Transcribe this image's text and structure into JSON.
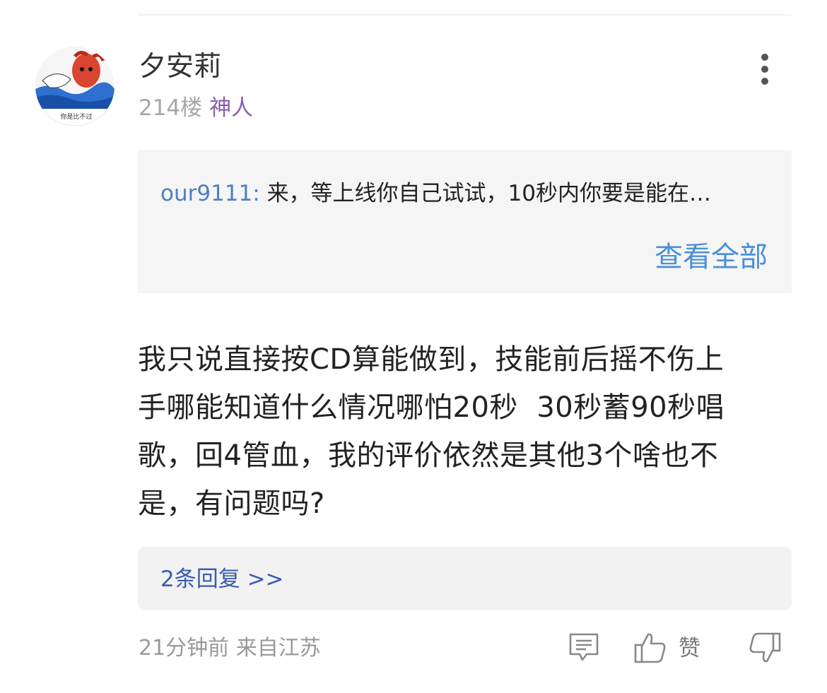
{
  "post": {
    "username": "夕安莉",
    "floor": "214楼",
    "badge": "神人",
    "quote": {
      "author": "our9111:",
      "text": "来，等上线你自己试试，10秒内你要是能在…",
      "view_all": "查看全部"
    },
    "lines": [
      "我只说直接按CD算能做到，技能前后摇不伤上",
      "手哪能知道什么情况哪怕20秒  30秒蓄90秒唱",
      "歌，回4管血，我的评价依然是其他3个啥也不",
      "是，有问题吗?"
    ],
    "replies_link": "2条回复 >>",
    "time_location": "21分钟前 来自江苏",
    "like_label": "赞"
  },
  "avatar": {
    "caption": "你是比不过"
  },
  "icons": {
    "more": "more-vertical-icon",
    "comment": "comment-icon",
    "like": "thumbs-up-icon",
    "dislike": "thumbs-down-icon"
  },
  "colors": {
    "author": "#4d7fc4",
    "badge": "#8a5cb0",
    "view_all": "#4a8fd8",
    "replies_link": "#3c5bb0",
    "muted": "#999999"
  }
}
